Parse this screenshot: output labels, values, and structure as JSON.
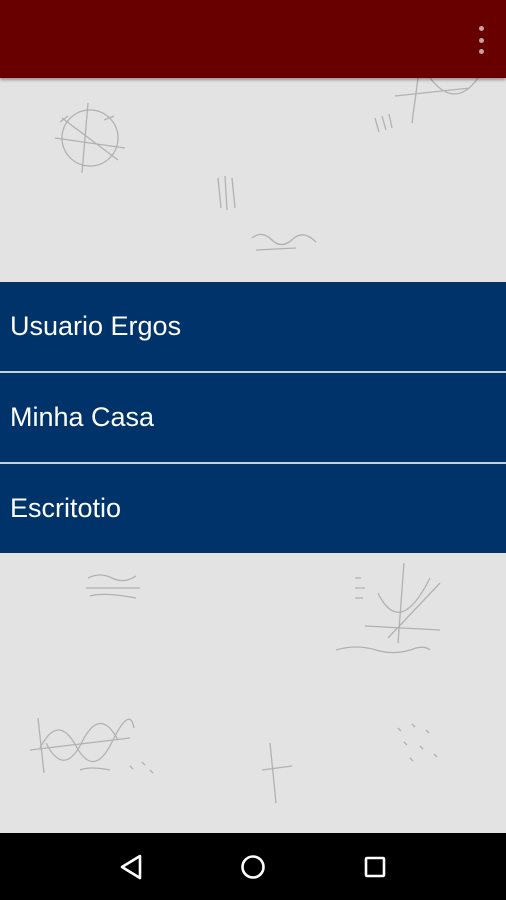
{
  "app_bar": {
    "background_color": "#680000",
    "menu_icon": "overflow-menu-icon"
  },
  "menu_list": {
    "item_color": "#00336a",
    "items": [
      {
        "label": "Usuario Ergos"
      },
      {
        "label": "Minha Casa"
      },
      {
        "label": "Escritotio"
      }
    ]
  },
  "nav_bar": {
    "buttons": [
      "back-icon",
      "home-icon",
      "recents-icon"
    ]
  }
}
